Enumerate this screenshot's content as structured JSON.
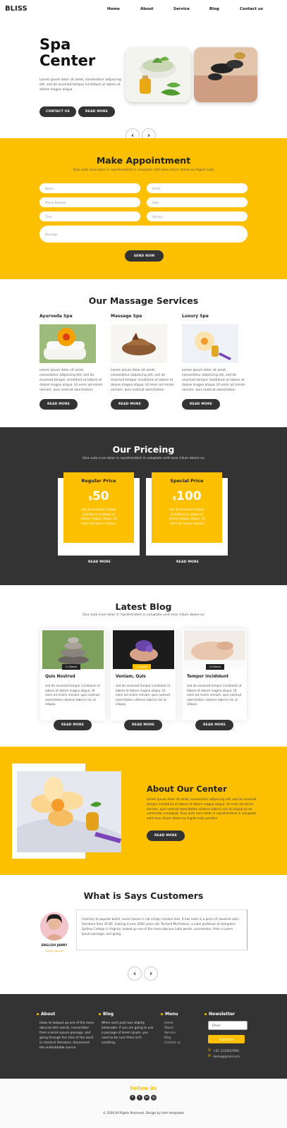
{
  "nav": {
    "logo": "BLISS",
    "items": [
      "Home",
      "About",
      "Service",
      "Blog",
      "Contact us"
    ]
  },
  "hero": {
    "title_line1": "Spa",
    "title_line2": "Center",
    "text": "Lorem ipsum dolor sit amet, consectetur adipiscing elit, sed do eiusmod tempor incididunt ut labore et dolore magna aliqua.",
    "btn_contact": "CONTACT US",
    "btn_read": "READ MORE",
    "prev": "‹",
    "next": "›"
  },
  "appointment": {
    "title": "Make Appointment",
    "subtitle": "Duis aute irure dolor in reprehenderit in voluptate velit esse cillum dolore eu fugiat nulla",
    "fields": [
      "Name",
      "Email",
      "Phone Number",
      "Date",
      "Time",
      "Service",
      "Message"
    ],
    "btn": "SEND NOW"
  },
  "services": {
    "title": "Our Massage Services",
    "items": [
      {
        "name": "Ayurveda Spa",
        "text": "Lorem ipsum dolor sit amet, consectetur adipiscing elit, sed do eiusmod tempor incididunt ut labore et dolore magna aliqua. Ut enim ad minim veniam, quis nostrud exercitation ullamco laboris nisi ut aliquip ex ea commodo.",
        "btn": "READ MORE"
      },
      {
        "name": "Massage Spa",
        "text": "Lorem ipsum dolor sit amet, consectetur adipiscing elit, sed do eiusmod tempor incididunt ut labore et dolore magna aliqua. Ut enim ad minim veniam, quis nostrud exercitation ullamco laboris nisi ut aliquip ex ea commodo.",
        "btn": "READ MORE"
      },
      {
        "name": "Luxury Spa",
        "text": "Lorem ipsum dolor sit amet, consectetur adipiscing elit, sed do eiusmod tempor incididunt ut labore et dolore magna aliqua. Ut enim ad minim veniam, quis nostrud exercitation ullamco laboris nisi ut aliquip ex ea commodo.",
        "btn": "READ MORE"
      }
    ]
  },
  "pricing": {
    "title": "Our Priceing",
    "subtitle": "Duis aute irure dolor in reprehenderit in voluptate velit esse cillum dolore eu",
    "plans": [
      {
        "name": "Regular Price",
        "currency": "$",
        "amount": "50",
        "text": "sed do eiusmod tempor incididunt ut labore et dolore magna aliqua. Ut enim ad minim veniam",
        "btn": "READ MORE"
      },
      {
        "name": "Special Price",
        "currency": "$",
        "amount": "100",
        "text": "sed do eiusmod tempor incididunt ut labore et dolore magna aliqua. Ut enim ad minim veniam",
        "btn": "READ MORE"
      }
    ]
  },
  "blog": {
    "title": "Latest Blog",
    "subtitle": "Duis aute irure dolor in reprehenderit in voluptate velit esse cillum dolore eu",
    "posts": [
      {
        "date": "11 March",
        "title": "Quis Nostrud",
        "text": "sed do eiusmod tempor incididunt ut labore et dolore magna aliqua. Ut enim ad minim veniam, quis nostrud exercitation ullamco laboris nisi ut aliquip.",
        "btn": "READ MORE"
      },
      {
        "date": "12 March",
        "title": "Veniam, Quis",
        "text": "sed do eiusmod tempor incididunt ut labore et dolore magna aliqua. Ut enim ad minim veniam, quis nostrud exercitation ullamco laboris nisi ut aliquip.",
        "btn": "READ MORE"
      },
      {
        "date": "13 March",
        "title": "Tempor Incididunt",
        "text": "sed do eiusmod tempor incididunt ut labore et dolore magna aliqua. Ut enim ad minim veniam, quis nostrud exercitation ullamco laboris nisi ut aliquip.",
        "btn": "READ MORE"
      }
    ]
  },
  "about": {
    "title": "About Our Center",
    "text": "Lorem ipsum dolor sit amet, consectetur adipiscing elit, sed do eiusmod tempor incididunt ut labore et dolore magna aliqua. Ut enim ad minim veniam, quis nostrud exercitation ullamco laboris nisi ut aliquip ex ea commodo consequat. Duis aute irure dolor in reprehenderit in voluptate velit esse cillum dolore eu fugiat nulla pariatur.",
    "btn": "READ MORE"
  },
  "testimonial": {
    "title": "What is Says Customers",
    "name": "ENGLISH JANNY",
    "role": "Lorem Ipsum",
    "text": "Contrary to popular belief, Lorem Ipsum is not simply random text. It has roots in a piece of classical Latin literature from 45 BC, making it over 2000 years old. Richard McClintock, a Latin professor at Hampden-Sydney College in Virginia, looked up one of the more obscure Latin words, consectetur, from a Lorem Ipsum passage, and going",
    "prev": "‹",
    "next": "›"
  },
  "footer": {
    "about_title": "About",
    "about_text": "Ideas to lookout up one of the more obscure latin words, consectetur from a lorem ipsum passage, and going through the cites of the word in classical literature, discovered the undoubtable source.",
    "blog_title": "Blog",
    "blog_text": "When each post was slightly believable. If you are going to use a passage of lorem ipsum, you need to be sure there isn't anything.",
    "menu_title": "Menu",
    "menu_items": [
      "Home",
      "About",
      "Service",
      "Blog",
      "Contact us"
    ],
    "news_title": "Newsletter",
    "email_placeholder": "Email",
    "subscribe": "Subscribe",
    "phone": "+01 1234567890",
    "mail": "demo@gmail.com",
    "follow": "Follow Us",
    "copyright": "© 2020 All Rights Reserved. Design by html templates"
  },
  "colors": {
    "accent": "#fdc000",
    "dark": "#333333"
  }
}
